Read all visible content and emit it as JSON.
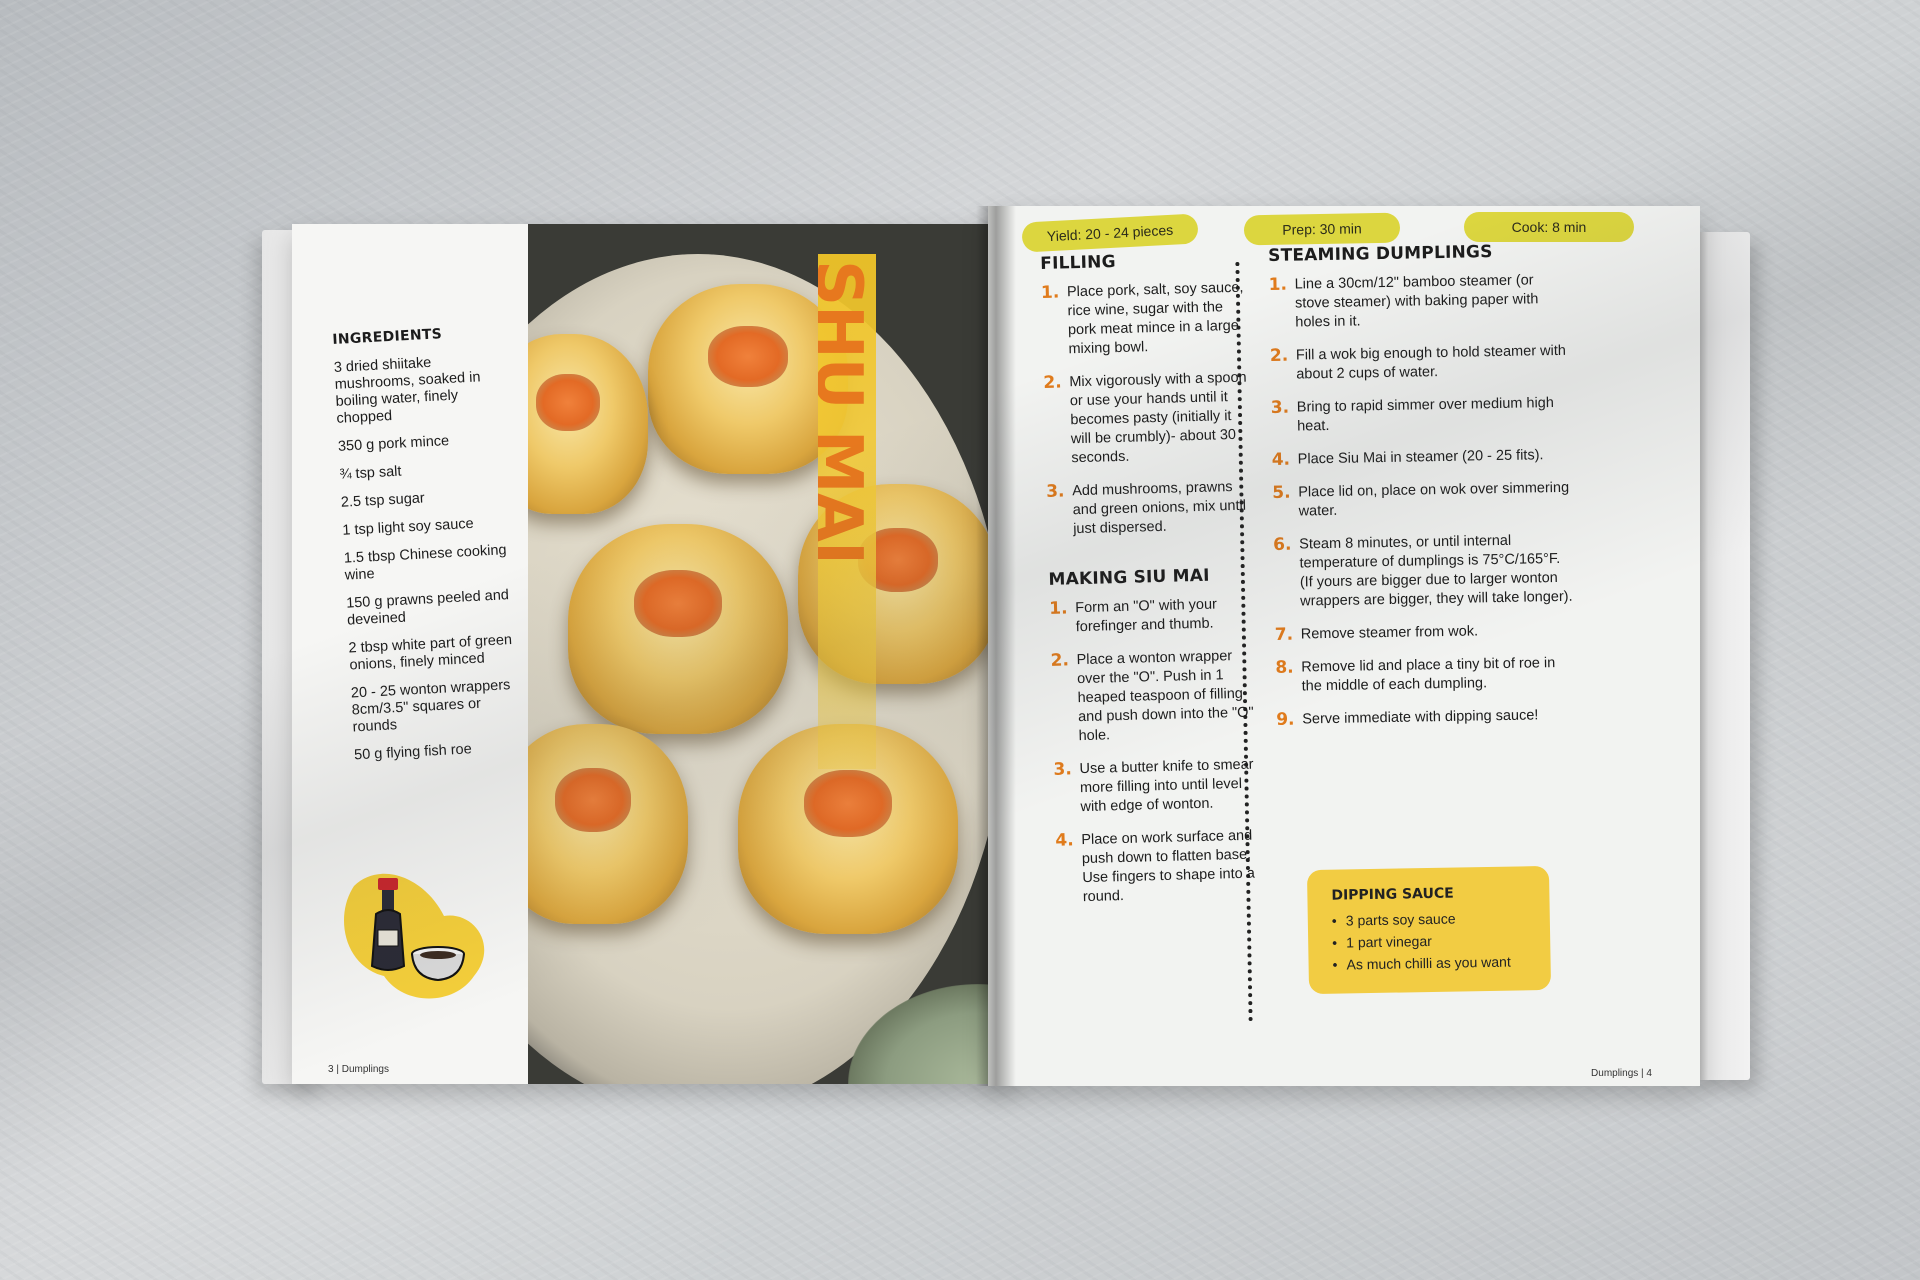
{
  "left_page": {
    "ingredients_title": "INGREDIENTS",
    "ingredients": [
      "3 dried shiitake mushrooms, soaked in boiling water, finely chopped",
      "350 g pork mince",
      "¾ tsp salt",
      "2.5 tsp sugar",
      "1 tsp light soy sauce",
      "1.5 tbsp Chinese cooking wine",
      "150 g prawns peeled and deveined",
      "2 tbsp white part of green onions, finely minced",
      "20 - 25 wonton wrappers 8cm/3.5\" squares or rounds",
      "50 g flying fish roe"
    ],
    "illustration_icon": "soy-sauce-bottle-icon",
    "folio": "3 | Dumplings"
  },
  "photo": {
    "title": "SHU MAI"
  },
  "right_page": {
    "pills": {
      "yield": "Yield: 20 - 24 pieces",
      "prep": "Prep: 30 min",
      "cook": "Cook: 8 min"
    },
    "filling": {
      "title": "FILLING",
      "steps": [
        {
          "num": "1.",
          "text": "Place pork, salt, soy sauce, rice wine, sugar with the pork meat mince in a large mixing bowl."
        },
        {
          "num": "2.",
          "text": "Mix vigorously with a spoon or use your hands until it becomes pasty (initially it will be crumbly)- about 30 seconds."
        },
        {
          "num": "3.",
          "text": "Add mushrooms, prawns and green onions, mix until just dispersed."
        }
      ]
    },
    "making": {
      "title": "MAKING SIU MAI",
      "steps": [
        {
          "num": "1.",
          "text": "Form an \"O\" with your forefinger and thumb."
        },
        {
          "num": "2.",
          "text": "Place a wonton wrapper over the \"O\". Push in 1 heaped teaspoon of filling and push down into the \"O\" hole."
        },
        {
          "num": "3.",
          "text": "Use a butter knife to smear more filling into until level with edge of wonton."
        },
        {
          "num": "4.",
          "text": "Place on work surface and push down to flatten base. Use fingers to shape into a round."
        }
      ]
    },
    "steaming": {
      "title": "STEAMING DUMPLINGS",
      "steps": [
        {
          "num": "1.",
          "text": "Line a 30cm/12\" bamboo steamer (or stove steamer) with baking paper with holes in it."
        },
        {
          "num": "2.",
          "text": "Fill a wok big enough to hold steamer with about 2 cups of water."
        },
        {
          "num": "3.",
          "text": "Bring to rapid simmer over medium high heat."
        },
        {
          "num": "4.",
          "text": "Place Siu Mai in steamer (20 - 25 fits)."
        },
        {
          "num": "5.",
          "text": "Place lid on, place on wok over simmering water."
        },
        {
          "num": "6.",
          "text": "Steam 8 minutes, or until internal temperature of dumplings is 75°C/165°F. (If yours are bigger due to larger wonton wrappers are bigger, they will take longer)."
        },
        {
          "num": "7.",
          "text": "Remove steamer from wok."
        },
        {
          "num": "8.",
          "text": "Remove lid and place a tiny bit of roe in the middle of each dumpling."
        },
        {
          "num": "9.",
          "text": "Serve immediate with dipping sauce!"
        }
      ]
    },
    "dipping_sauce": {
      "title": "DIPPING SAUCE",
      "items": [
        "3 parts soy sauce",
        "1 part vinegar",
        "As much chilli as you want"
      ]
    },
    "folio": "Dumplings | 4"
  },
  "colors": {
    "accent_orange": "#e07b1c",
    "pill_yellow": "#dcd63f",
    "box_yellow": "#f2cc43"
  }
}
